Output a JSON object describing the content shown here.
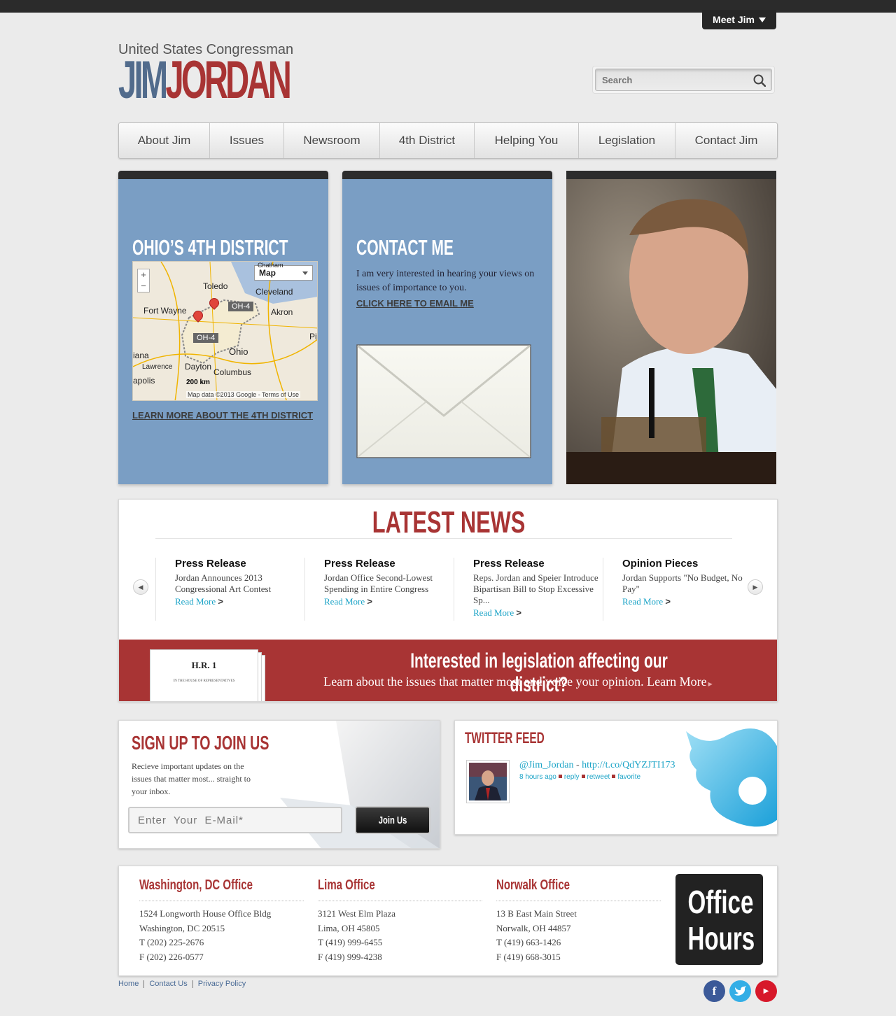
{
  "header": {
    "meet_label": "Meet Jim",
    "logo_sub": "United States Congressman",
    "logo_first": "JIM",
    "logo_last": "JORDAN",
    "search_placeholder": "Search"
  },
  "nav": {
    "items": [
      {
        "label": "About Jim"
      },
      {
        "label": "Issues"
      },
      {
        "label": "Newsroom"
      },
      {
        "label": "4th District"
      },
      {
        "label": "Helping You"
      },
      {
        "label": "Legislation"
      },
      {
        "label": "Contact Jim"
      }
    ]
  },
  "district": {
    "title": "OHIO’S 4TH DISTRICT",
    "link": "LEARN MORE ABOUT THE 4TH DISTRICT",
    "map": {
      "type_label": "Map",
      "cities": [
        "Toledo",
        "Cleveland",
        "Fort Wayne",
        "Akron",
        "Ohio",
        "Dayton",
        "Columbus",
        "Lawrence",
        "iana",
        "apolis",
        "Pit",
        "Chatham"
      ],
      "tag": "OH-4",
      "scale": "200 km",
      "credit": "Map data ©2013 Google - Terms of Use"
    }
  },
  "contact": {
    "title": "CONTACT ME",
    "text": "I am very interested in hearing your views on issues of importance to you.",
    "link": "CLICK HERE TO EMAIL ME"
  },
  "news": {
    "title": "LATEST NEWS",
    "items": [
      {
        "category": "Press Release",
        "headline": "Jordan Announces 2013 Congressional Art Contest",
        "more": "Read More"
      },
      {
        "category": "Press Release",
        "headline": "Jordan Office Second-Lowest Spending in Entire Congress",
        "more": "Read More"
      },
      {
        "category": "Press Release",
        "headline": "Reps. Jordan and Speier Introduce Bipartisan Bill to Stop Excessive Sp...",
        "more": "Read More"
      },
      {
        "category": "Opinion Pieces",
        "headline": "Jordan Supports \"No Budget, No Pay\"",
        "more": "Read More"
      }
    ]
  },
  "legislation": {
    "heading": "Interested in legislation affecting our district?",
    "sub": "Learn about the issues that matter most and voice your opinion.  Learn More",
    "paper_title": "H.R. 1",
    "paper_line": "IN THE HOUSE OF REPRESENTATIVES"
  },
  "signup": {
    "title": "SIGN UP TO JOIN US",
    "text": "Recieve important updates on the issues that matter most... straight to your inbox.",
    "email_placeholder": "Enter  Your  E-Mail*",
    "button": "Join Us"
  },
  "twitter": {
    "title": "TWITTER FEED",
    "handle": "@Jim_Jordan",
    "dash": " - ",
    "link": "http://t.co/QdYZJTI173",
    "time": "8 hours ago",
    "reply": "reply",
    "retweet": "retweet",
    "favorite": "favorite"
  },
  "offices": [
    {
      "title": "Washington, DC Office",
      "line1": "1524 Longworth House Office Bldg",
      "line2": "Washington, DC 20515",
      "phone": "T (202) 225-2676",
      "fax": "F (202) 226-0577"
    },
    {
      "title": "Lima Office",
      "line1": "3121 West Elm Plaza",
      "line2": "Lima, OH 45805",
      "phone": "T (419) 999-6455",
      "fax": "F (419) 999-4238"
    },
    {
      "title": "Norwalk Office",
      "line1": "13 B East Main Street",
      "line2": "Norwalk, OH 44857",
      "phone": "T (419) 663-1426",
      "fax": "F (419) 668-3015"
    }
  ],
  "office_hours": {
    "line1": "Office",
    "line2": "Hours"
  },
  "footer": {
    "links": [
      "Home",
      "Contact Us",
      "Privacy Policy"
    ],
    "social": [
      {
        "icon": "facebook-icon",
        "glyph": "f",
        "color": "#3b5998"
      },
      {
        "icon": "twitter-icon",
        "glyph": "t",
        "color": "#33aee6"
      },
      {
        "icon": "youtube-icon",
        "glyph": "▶",
        "color": "#d7182a"
      }
    ]
  },
  "colors": {
    "brand_red": "#a83434",
    "brand_blue": "#7a9ec4",
    "link_blue": "#1ca4c7"
  }
}
